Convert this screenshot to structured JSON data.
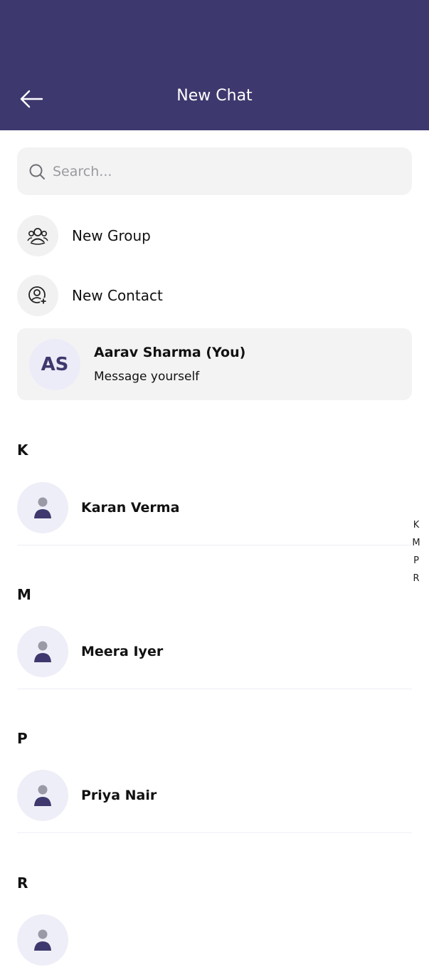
{
  "header": {
    "title": "New Chat",
    "back_icon": "arrow-left-icon",
    "background_color": "#3d386d"
  },
  "search": {
    "placeholder": "Search...",
    "value": "",
    "icon": "search-icon"
  },
  "actions": [
    {
      "label": "New Group",
      "icon": "group-icon"
    },
    {
      "label": "New Contact",
      "icon": "add-contact-icon"
    }
  ],
  "self": {
    "initials": "AS",
    "name": "Aarav Sharma (You)",
    "subtitle": "Message yourself"
  },
  "sections": [
    {
      "letter": "K",
      "contacts": [
        {
          "name": "Karan Verma"
        }
      ]
    },
    {
      "letter": "M",
      "contacts": [
        {
          "name": "Meera Iyer"
        }
      ]
    },
    {
      "letter": "P",
      "contacts": [
        {
          "name": "Priya Nair"
        }
      ]
    },
    {
      "letter": "R",
      "contacts": [
        {
          "name": ""
        }
      ]
    }
  ],
  "index": [
    "K",
    "M",
    "P",
    "R"
  ],
  "colors": {
    "accent": "#3d386d",
    "avatar_bg": "#eeeef8",
    "card_bg": "#f3f3f4"
  }
}
